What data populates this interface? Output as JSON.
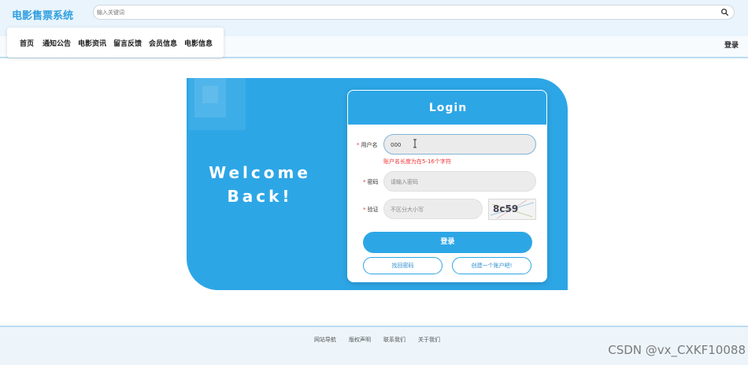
{
  "header": {
    "site_title": "电影售票系统",
    "search_placeholder": "输入关键词",
    "search_icon": "search-icon"
  },
  "nav": {
    "items": [
      "首页",
      "通知公告",
      "电影资讯",
      "留言反馈",
      "会员信息",
      "电影信息"
    ],
    "login": "登录"
  },
  "welcome": {
    "line1": "Welcome",
    "line2": "Back!"
  },
  "login": {
    "title": "Login",
    "username_label": "用户名",
    "username_value": "000",
    "username_error": "账户名长度为在5-16个字符",
    "password_label": "密码",
    "password_placeholder": "请输入密码",
    "captcha_label": "验证",
    "captcha_placeholder": "不区分大小写",
    "captcha_text": "8c59",
    "submit": "登录",
    "forgot": "找回密码",
    "register": "创建一个账户吧!"
  },
  "footer": {
    "links": [
      "网站导航",
      "版权声明",
      "联系我们",
      "关于我们"
    ]
  },
  "watermark": "CSDN @vx_CXKF10088",
  "colors": {
    "accent": "#2da6e6",
    "error": "#e33333"
  }
}
